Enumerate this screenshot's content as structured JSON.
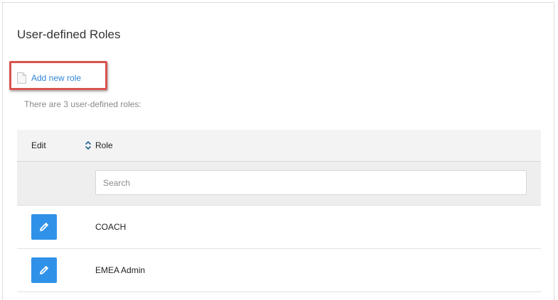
{
  "section": {
    "title": "User-defined Roles",
    "add_link_label": "Add new role",
    "count_text": "There are 3 user-defined roles:"
  },
  "table": {
    "columns": [
      "Edit",
      "Role"
    ],
    "search_placeholder": "Search",
    "rows": [
      {
        "role": "COACH"
      },
      {
        "role": "EMEA Admin"
      }
    ]
  },
  "icons": {
    "add": "document-icon",
    "sort": "sort-icon",
    "edit": "pencil-icon"
  },
  "colors": {
    "link": "#2f86d4",
    "edit_button": "#2f92e8",
    "highlight_box": "#d9534f",
    "sort_icon": "#1f5f8b"
  }
}
